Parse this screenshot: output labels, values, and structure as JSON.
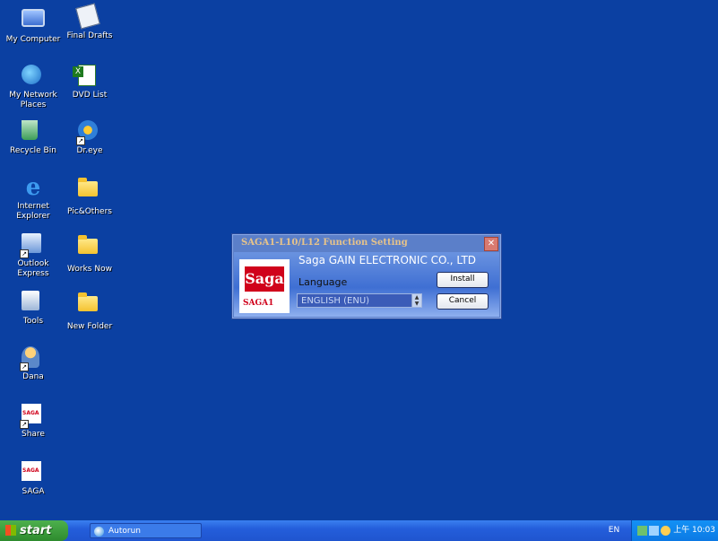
{
  "desktop": {
    "icons": [
      {
        "label": "My Computer",
        "icon": "computer-icon"
      },
      {
        "label": "Final Drafts",
        "icon": "drafts-icon"
      },
      {
        "label": "My Network Places",
        "icon": "network-icon"
      },
      {
        "label": "DVD List",
        "icon": "excel-icon"
      },
      {
        "label": "Recycle Bin",
        "icon": "recycle-bin-icon"
      },
      {
        "label": "Dr.eye",
        "icon": "dreye-icon"
      },
      {
        "label": "Internet Explorer",
        "icon": "ie-icon"
      },
      {
        "label": "Pic&Others",
        "icon": "folder-icon"
      },
      {
        "label": "Outlook Express",
        "icon": "outlook-icon"
      },
      {
        "label": "Works Now",
        "icon": "folder-icon"
      },
      {
        "label": "Tools",
        "icon": "tools-icon"
      },
      {
        "label": "New Folder",
        "icon": "folder-icon"
      },
      {
        "label": "Dana",
        "icon": "dana-icon"
      },
      {
        "label": "Share",
        "icon": "saga-icon"
      },
      {
        "label": "SAGA",
        "icon": "saga-icon"
      }
    ]
  },
  "dialog": {
    "title": "SAGA1-L10/L12  Function Setting",
    "close": "✕",
    "company": "Saga GAIN ELECTRONIC CO., LTD",
    "logo_mark": "Saga",
    "logo_sub": "SAGA1",
    "language_label": "Language",
    "language_value": "ENGLISH (ENU)",
    "install_label": "Install",
    "cancel_label": "Cancel"
  },
  "taskbar": {
    "start_label": "start",
    "tasks": [
      {
        "label": "Autorun"
      }
    ],
    "language": "EN",
    "clock": "上午 10:03"
  },
  "colors": {
    "desktop": "#0b40a2",
    "taskbar": "#245edb",
    "start": "#2e8b2e",
    "brand_red": "#d0021b"
  }
}
